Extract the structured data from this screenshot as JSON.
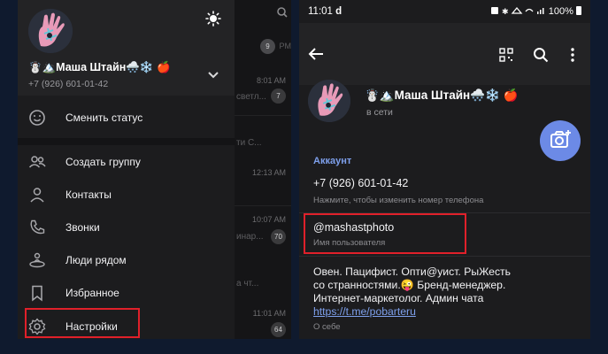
{
  "left_phone": {
    "profile": {
      "name": "☃️🏔️Маша Штайн🌨️❄️ 🍎",
      "phone": "+7 (926) 601-01-42"
    },
    "menu": [
      {
        "label": "Сменить статус",
        "icon": "smile-icon"
      },
      {
        "label": "Создать группу",
        "icon": "group-icon"
      },
      {
        "label": "Контакты",
        "icon": "person-icon"
      },
      {
        "label": "Звонки",
        "icon": "phone-icon"
      },
      {
        "label": "Люди рядом",
        "icon": "people-nearby-icon"
      },
      {
        "label": "Избранное",
        "icon": "bookmark-icon"
      },
      {
        "label": "Настройки",
        "icon": "gear-icon"
      }
    ],
    "chat_list_fragments": {
      "times": [
        "8:01 AM",
        "12:13 AM",
        "10:07 AM",
        "11:01 AM"
      ],
      "badges": [
        "9",
        "7",
        "70",
        "64"
      ],
      "snippets": [
        "светл...",
        "ти С...",
        "инар...",
        "а чт..."
      ],
      "extra": "PM"
    }
  },
  "right_phone": {
    "status_bar": {
      "time": "11:01",
      "indicator": "d",
      "right": "100%"
    },
    "profile": {
      "name": "☃️🏔️Маша Штайн🌨️❄️ 🍎",
      "status": "в сети"
    },
    "account": {
      "section_title": "Аккаунт",
      "phone_value": "+7 (926) 601-01-42",
      "phone_hint": "Нажмите, чтобы изменить номер телефона",
      "username_value": "@mashastphoto",
      "username_hint": "Имя пользователя",
      "bio_lines": [
        "Овен. Пацифист. Опти@уист. РыЖесть",
        "со странностями.😜 Бренд-менеджер.",
        "Интернет-маркетолог. Админ чата"
      ],
      "bio_link": "https://t.me/pobarteru",
      "bio_hint": "О себе"
    }
  },
  "colors": {
    "background": "#0f1a2e",
    "accent": "#7ea0ec",
    "highlight": "#e0202a",
    "fab": "#6c8ae6"
  }
}
